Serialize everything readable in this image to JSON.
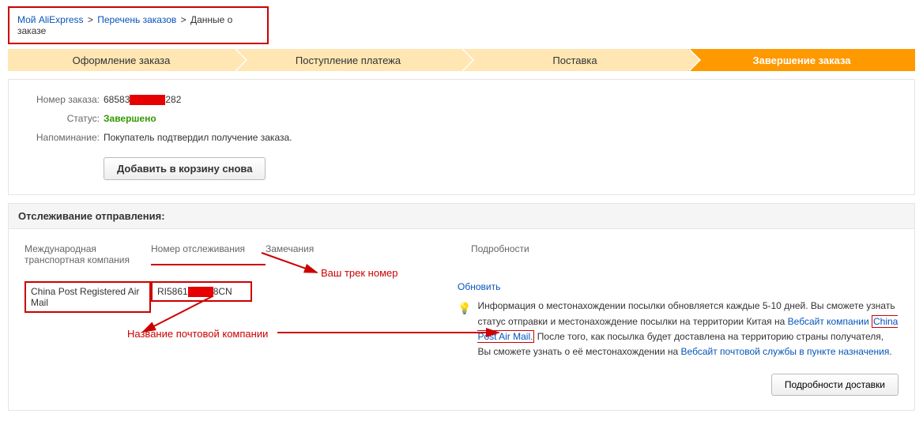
{
  "breadcrumb": {
    "home": "Мой AliExpress",
    "orders": "Перечень заказов",
    "current": "Данные о заказе"
  },
  "progress": {
    "step1": "Оформление заказа",
    "step2": "Поступление платежа",
    "step3": "Поставка",
    "step4": "Завершение заказа"
  },
  "order": {
    "orderno_label": "Номер заказа:",
    "orderno_pre": "68583",
    "orderno_post": "282",
    "status_label": "Статус:",
    "status_value": "Завершено",
    "reminder_label": "Напоминание:",
    "reminder_value": "Покупатель подтвердил получение заказа.",
    "add_to_cart": "Добавить в корзину снова"
  },
  "tracking": {
    "header": "Отслеживание отправления:",
    "th_company": "Международная транспортная компания",
    "th_trackno": "Номер отслеживания",
    "th_remarks": "Замечания",
    "th_details": "Подробности",
    "company": "China Post Registered Air Mail",
    "trackno_pre": "RI5861",
    "trackno_post": "8CN",
    "refresh": "Обновить",
    "info_text_1": "Информация о местонахождении посылки обновляется каждые 5-10 дней. Вы сможете узнать статус отправки и местонахождение посылки на территории Китая на ",
    "info_link_1a": "Вебсайт компании ",
    "info_link_1b": "China Post Air Mail.",
    "info_text_2": " После того, как посылка будет доставлена на территорию страны получателя, Вы сможете узнать о её местонахождении на ",
    "info_link_2": "Вебсайт почтовой службы в пункте назначения",
    "details_btn": "Подробности доставки"
  },
  "annotations": {
    "track_number": "Ваш трек номер",
    "company_name": "Название почтовой компании"
  }
}
